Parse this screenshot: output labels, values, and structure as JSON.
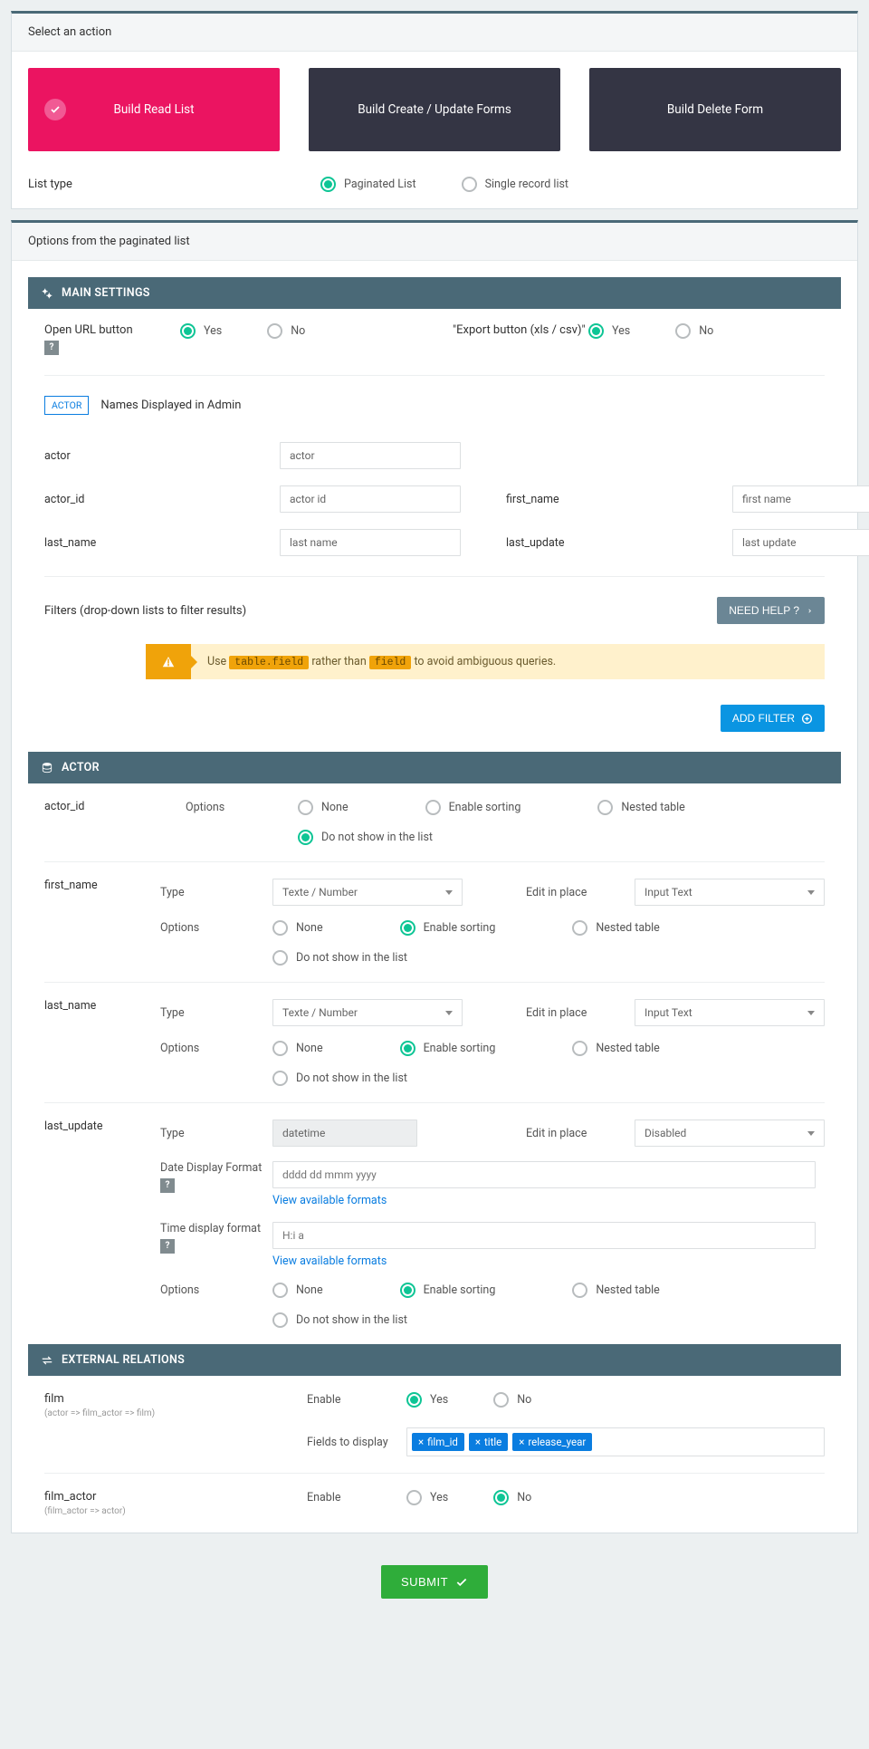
{
  "actions": {
    "header": "Select an action",
    "items": [
      "Build Read List",
      "Build Create / Update Forms",
      "Build Delete Form"
    ],
    "list_type_label": "List type",
    "list_type_options": [
      "Paginated List",
      "Single record list"
    ]
  },
  "options": {
    "header": "Options from the paginated list",
    "main_settings": {
      "title": "MAIN SETTINGS",
      "open_url": "Open URL button",
      "export": "\"Export button (xls / csv)\"",
      "yes": "Yes",
      "no": "No"
    },
    "names": {
      "chip": "ACTOR",
      "title": "Names Displayed in Admin",
      "fields": {
        "actor": {
          "label": "actor",
          "value": "actor"
        },
        "actor_id": {
          "label": "actor_id",
          "value": "actor id"
        },
        "first_name": {
          "label": "first_name",
          "value": "first name"
        },
        "last_name": {
          "label": "last_name",
          "value": "last name"
        },
        "last_update": {
          "label": "last_update",
          "value": "last update"
        }
      }
    },
    "filters": {
      "title": "Filters (drop-down lists to filter results)",
      "need_help": "NEED HELP ?",
      "alert": {
        "pre": "Use ",
        "code1": "table.field",
        "mid": " rather than ",
        "code2": "field",
        "post": " to avoid ambiguous queries."
      },
      "add_filter": "ADD FILTER"
    },
    "actor": {
      "title": "ACTOR",
      "type_label": "Type",
      "options_label": "Options",
      "eip_label": "Edit in place",
      "date_fmt_label": "Date Display Format",
      "time_fmt_label": "Time display format",
      "view_fmt": "View available formats",
      "opts": {
        "none": "None",
        "sort": "Enable sorting",
        "nested": "Nested table",
        "hide": "Do not show in the list"
      },
      "type_text": "Texte / Number",
      "type_dt": "datetime",
      "eip_text": "Input Text",
      "eip_disabled": "Disabled",
      "date_ph": "dddd dd mmm yyyy",
      "time_ph": "H:i a",
      "cols": {
        "actor_id": "actor_id",
        "first_name": "first_name",
        "last_name": "last_name",
        "last_update": "last_update"
      }
    },
    "external": {
      "title": "EXTERNAL RELATIONS",
      "enable": "Enable",
      "fields_to_display": "Fields to display",
      "yes": "Yes",
      "no": "No",
      "film": {
        "name": "film",
        "path": "(actor => film_actor => film)"
      },
      "film_actor": {
        "name": "film_actor",
        "path": "(film_actor => actor)"
      },
      "tags": [
        "film_id",
        "title",
        "release_year"
      ]
    }
  },
  "submit": "SUBMIT"
}
